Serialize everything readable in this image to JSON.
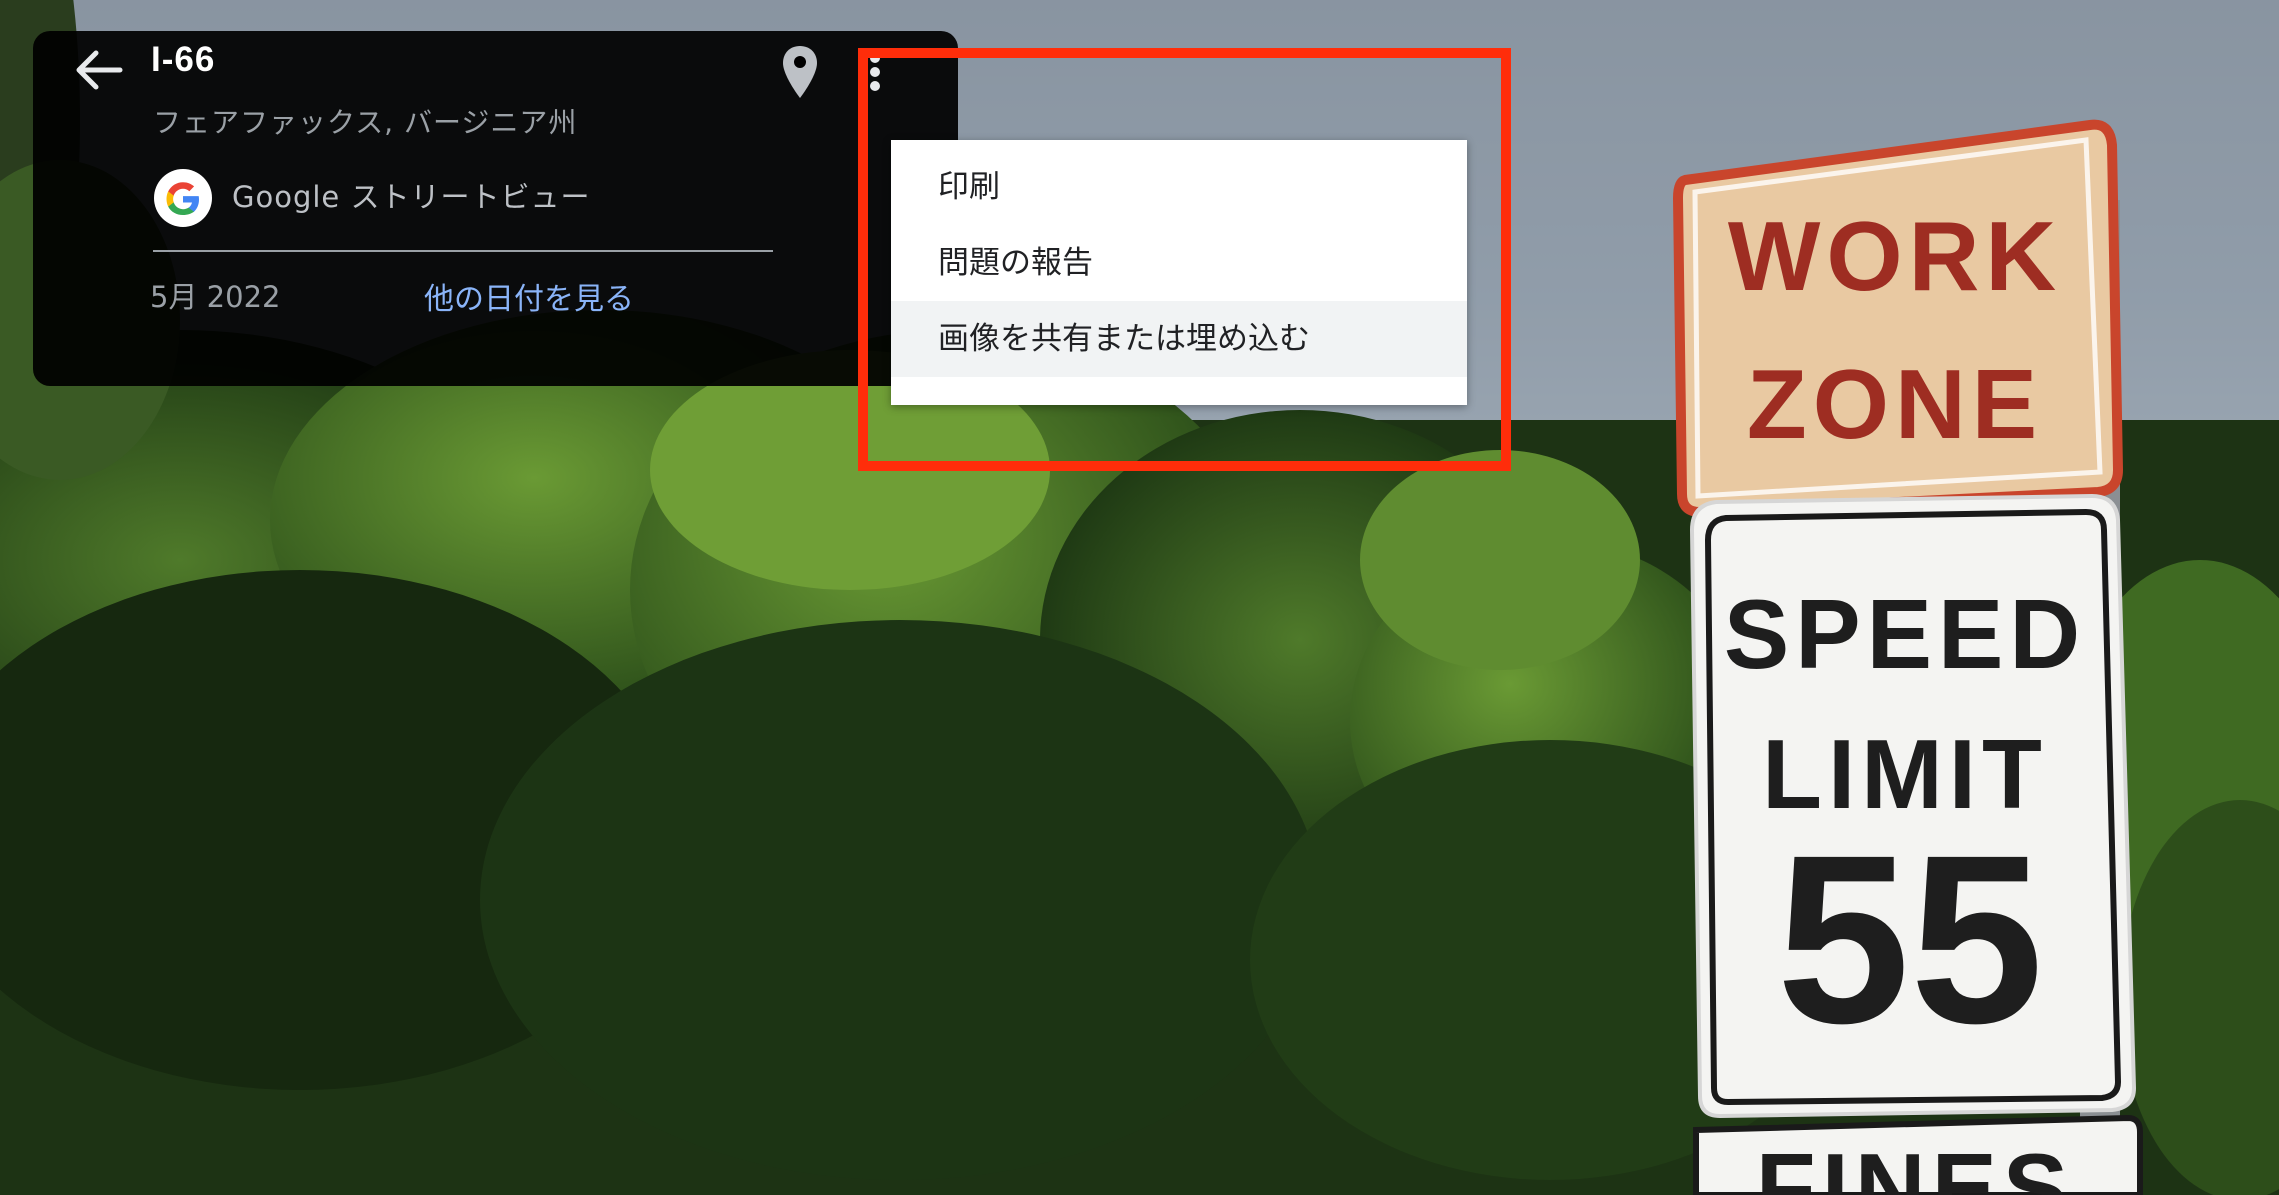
{
  "header": {
    "title": "I-66",
    "location": "フェアファックス, バージニア州",
    "source": "Google ストリートビュー",
    "date": "5月 2022",
    "other_dates_link": "他の日付を見る"
  },
  "icons": {
    "back": "arrow-back-icon",
    "pin": "location-pin-icon",
    "more": "more-vert-icon",
    "logo": "google-logo"
  },
  "menu": {
    "items": [
      {
        "label": "印刷"
      },
      {
        "label": "問題の報告"
      },
      {
        "label": "画像を共有または埋め込む"
      }
    ]
  },
  "signs": {
    "work_zone": [
      "WORK",
      "ZONE"
    ],
    "speed": [
      "SPEED",
      "LIMIT"
    ],
    "speed_value": "55",
    "bottom_partial": "FINES"
  },
  "colors": {
    "annotation_box": "#ff2d0a",
    "link": "#8ab4f8",
    "card_bg": "#000000",
    "sign_text": "#a8322a"
  }
}
